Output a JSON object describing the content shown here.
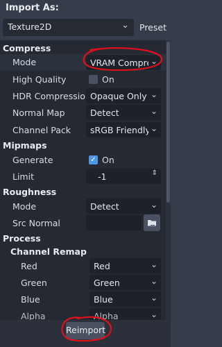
{
  "header": {
    "title": "Import As:",
    "preset_label": "Preset"
  },
  "import_type": {
    "value": "Texture2D"
  },
  "sections": {
    "compress": "Compress",
    "mipmaps": "Mipmaps",
    "roughness": "Roughness",
    "process": "Process",
    "channel_remap": "Channel Remap"
  },
  "compress": {
    "mode": {
      "label": "Mode",
      "value": "VRAM Compres"
    },
    "high_quality": {
      "label": "High Quality",
      "value": "On",
      "checked": false
    },
    "hdr_compression": {
      "label": "HDR Compression",
      "value": "Opaque Only"
    },
    "normal_map": {
      "label": "Normal Map",
      "value": "Detect"
    },
    "channel_pack": {
      "label": "Channel Pack",
      "value": "sRGB Friendly"
    }
  },
  "mipmaps": {
    "generate": {
      "label": "Generate",
      "value": "On",
      "checked": true
    },
    "limit": {
      "label": "Limit",
      "value": "-1"
    }
  },
  "roughness": {
    "mode": {
      "label": "Mode",
      "value": "Detect"
    },
    "src_normal": {
      "label": "Src Normal",
      "value": ""
    }
  },
  "channel_remap": {
    "red": {
      "label": "Red",
      "value": "Red"
    },
    "green": {
      "label": "Green",
      "value": "Green"
    },
    "blue": {
      "label": "Blue",
      "value": "Blue"
    },
    "alpha": {
      "label": "Alpha",
      "value": "Alpha"
    }
  },
  "footer": {
    "reimport_label": "Reimport"
  },
  "colors": {
    "accent": "#4f96e6",
    "annotation": "#e0101a"
  },
  "icons": [
    "chevron-down-icon",
    "checkmark-icon",
    "folder-icon"
  ]
}
